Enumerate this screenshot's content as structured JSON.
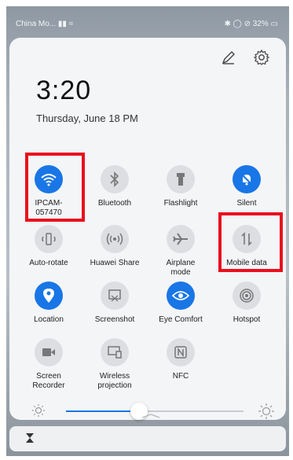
{
  "status_bar": {
    "carrier": "China Mo...",
    "battery": "32%"
  },
  "header": {
    "time": "3:20",
    "date": "Thursday, June 18  PM",
    "edit_icon": "pencil-icon",
    "settings_icon": "gear-icon"
  },
  "tiles": [
    {
      "label": "IPCAM-\n057470",
      "icon": "wifi-icon",
      "active": true,
      "highlighted": true
    },
    {
      "label": "Bluetooth",
      "icon": "bluetooth-icon",
      "active": false
    },
    {
      "label": "Flashlight",
      "icon": "flashlight-icon",
      "active": false
    },
    {
      "label": "Silent",
      "icon": "silent-bell-icon",
      "active": true
    },
    {
      "label": "Auto-rotate",
      "icon": "auto-rotate-icon",
      "active": false
    },
    {
      "label": "Huawei Share",
      "icon": "huawei-share-icon",
      "active": false
    },
    {
      "label": "Airplane\nmode",
      "icon": "airplane-icon",
      "active": false
    },
    {
      "label": "Mobile data",
      "icon": "mobile-data-icon",
      "active": false,
      "highlighted": true
    },
    {
      "label": "Location",
      "icon": "location-pin-icon",
      "active": true
    },
    {
      "label": "Screenshot",
      "icon": "screenshot-icon",
      "active": false
    },
    {
      "label": "Eye Comfort",
      "icon": "eye-icon",
      "active": true
    },
    {
      "label": "Hotspot",
      "icon": "hotspot-icon",
      "active": false
    },
    {
      "label": "Screen\nRecorder",
      "icon": "video-camera-icon",
      "active": false
    },
    {
      "label": "Wireless\nprojection",
      "icon": "projection-icon",
      "active": false
    },
    {
      "label": "NFC",
      "icon": "nfc-icon",
      "active": false
    }
  ],
  "brightness": {
    "level": 0.3,
    "accent": "#1976e6"
  },
  "colors": {
    "active": "#1976e6",
    "inactive": "#dcdee2",
    "highlight": "#e8101d"
  }
}
